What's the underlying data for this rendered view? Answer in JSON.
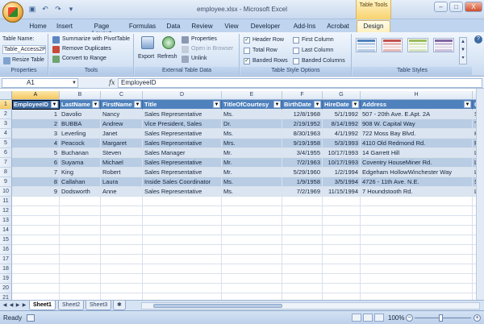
{
  "window": {
    "title": "employee.xlsx - Microsoft Excel",
    "context_group": "Table Tools",
    "controls": [
      "–",
      "□",
      "X"
    ]
  },
  "tabs": [
    "Home",
    "Insert",
    "Page Layout",
    "Formulas",
    "Data",
    "Review",
    "View",
    "Developer",
    "Add-Ins",
    "Acrobat",
    "Design"
  ],
  "active_tab": "Design",
  "ribbon": {
    "properties": {
      "table_name_label": "Table Name:",
      "table_name_value": "Table_Access2Po",
      "resize_label": "Resize Table",
      "group_label": "Properties"
    },
    "tools": {
      "summarize_label": "Summarize with PivotTable",
      "remove_dup_label": "Remove Duplicates",
      "convert_label": "Convert to Range",
      "group_label": "Tools"
    },
    "external": {
      "export_label": "Export",
      "refresh_label": "Refresh",
      "properties_label": "Properties",
      "open_browser_label": "Open in Browser",
      "unlink_label": "Unlink",
      "group_label": "External Table Data"
    },
    "style_options": {
      "header_row": "Header Row",
      "total_row": "Total Row",
      "banded_rows": "Banded Rows",
      "first_column": "First Column",
      "last_column": "Last Column",
      "banded_columns": "Banded Columns",
      "checked": {
        "header_row": true,
        "total_row": false,
        "banded_rows": true,
        "first_column": false,
        "last_column": false,
        "banded_columns": false
      },
      "group_label": "Table Style Options"
    },
    "table_styles": {
      "group_label": "Table Styles"
    }
  },
  "formula_bar": {
    "name_box": "A1",
    "fx": "fx",
    "formula": "EmployeeID"
  },
  "columns": [
    "A",
    "B",
    "C",
    "D",
    "E",
    "F",
    "G",
    "H",
    "I"
  ],
  "row_numbers": [
    "1",
    "2",
    "3",
    "4",
    "5",
    "6",
    "7",
    "8",
    "9",
    "10",
    "11",
    "12",
    "13",
    "14",
    "15",
    "16",
    "17",
    "18",
    "19",
    "20",
    "21"
  ],
  "table": {
    "headers": [
      "EmployeeID",
      "LastName",
      "FirstName",
      "Title",
      "TitleOfCourtesy",
      "BirthDate",
      "HireDate",
      "Address",
      "C"
    ],
    "rows": [
      [
        "1",
        "Davolio",
        "Nancy",
        "Sales Representative",
        "Ms.",
        "12/8/1968",
        "5/1/1992",
        "507 - 20th Ave. E.Apt. 2A",
        "S"
      ],
      [
        "2",
        "BUBBA",
        "Andrew",
        "Vice President, Sales",
        "Dr.",
        "2/19/1952",
        "8/14/1992",
        "908 W. Capital Way",
        "T"
      ],
      [
        "3",
        "Leverling",
        "Janet",
        "Sales Representative",
        "Ms.",
        "8/30/1963",
        "4/1/1992",
        "722 Moss Bay Blvd.",
        "K"
      ],
      [
        "4",
        "Peacock",
        "Margaret",
        "Sales Representative",
        "Mrs.",
        "9/19/1958",
        "5/3/1993",
        "4110 Old Redmond Rd.",
        "R"
      ],
      [
        "5",
        "Buchanan",
        "Steven",
        "Sales Manager",
        "Mr.",
        "3/4/1955",
        "10/17/1993",
        "14 Garrett Hill",
        "L"
      ],
      [
        "6",
        "Suyama",
        "Michael",
        "Sales Representative",
        "Mr.",
        "7/2/1963",
        "10/17/1993",
        "Coventry HouseMiner Rd.",
        "L"
      ],
      [
        "7",
        "King",
        "Robert",
        "Sales Representative",
        "Mr.",
        "5/29/1960",
        "1/2/1994",
        "Edgeham HollowWinchester Way",
        "L"
      ],
      [
        "8",
        "Callahan",
        "Laura",
        "Inside Sales Coordinator",
        "Ms.",
        "1/9/1958",
        "3/5/1994",
        "4726 - 11th Ave. N.E.",
        "S"
      ],
      [
        "9",
        "Dodsworth",
        "Anne",
        "Sales Representative",
        "Ms.",
        "7/2/1969",
        "11/15/1994",
        "7 Houndstooth Rd.",
        "L"
      ]
    ]
  },
  "sheets": [
    "Sheet1",
    "Sheet2",
    "Sheet3"
  ],
  "active_sheet": "Sheet1",
  "status": {
    "ready": "Ready",
    "zoom": "100%",
    "zoom_minus": "−",
    "zoom_plus": "+"
  },
  "colors": {
    "header_blue": "#4f81bd",
    "band_light": "#dbe5f1",
    "band_dark": "#b8cce4",
    "design_tab": "#fdf0c0"
  }
}
